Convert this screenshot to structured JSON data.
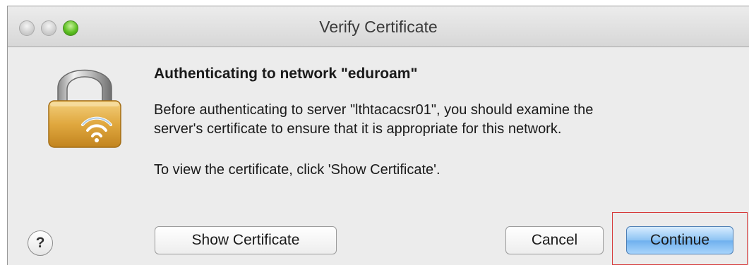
{
  "window": {
    "title": "Verify Certificate"
  },
  "dialog": {
    "heading": "Authenticating to network \"eduroam\"",
    "message_line1": "Before authenticating to server \"lthtacacsr01\", you should examine the",
    "message_line2": "server's certificate to ensure that it is appropriate for this network.",
    "message_line3": "To view the certificate, click 'Show Certificate'."
  },
  "buttons": {
    "help_label": "?",
    "show_certificate_label": "Show Certificate",
    "cancel_label": "Cancel",
    "continue_label": "Continue"
  },
  "icons": {
    "lock": "wifi-lock-icon",
    "close": "close-icon",
    "minimize": "minimize-icon",
    "zoom": "zoom-icon"
  },
  "colors": {
    "default_button": "#8dc3f3",
    "highlight_box": "#d63a3a",
    "zoom_button": "#5ec023"
  }
}
